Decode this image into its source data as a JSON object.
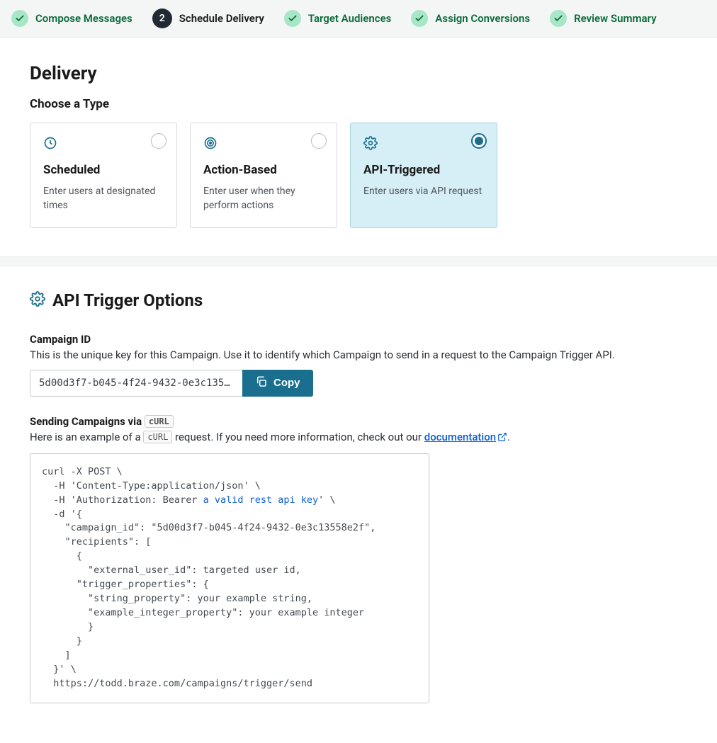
{
  "stepper": {
    "steps": [
      {
        "label": "Compose Messages",
        "state": "completed"
      },
      {
        "label": "Schedule Delivery",
        "state": "active",
        "number": "2"
      },
      {
        "label": "Target Audiences",
        "state": "completed"
      },
      {
        "label": "Assign Conversions",
        "state": "completed"
      },
      {
        "label": "Review Summary",
        "state": "completed"
      }
    ]
  },
  "delivery": {
    "title": "Delivery",
    "subtitle": "Choose a Type",
    "types": [
      {
        "title": "Scheduled",
        "desc": "Enter users at designated times",
        "selected": false,
        "icon": "clock"
      },
      {
        "title": "Action-Based",
        "desc": "Enter user when they perform actions",
        "selected": false,
        "icon": "target"
      },
      {
        "title": "API-Triggered",
        "desc": "Enter users via API request",
        "selected": true,
        "icon": "gear"
      }
    ]
  },
  "api": {
    "header": "API Trigger Options",
    "campaign_id_label": "Campaign ID",
    "campaign_id_desc": "This is the unique key for this Campaign. Use it to identify which Campaign to send in a request to the Campaign Trigger API.",
    "campaign_id_value": "5d00d3f7-b045-4f24-9432-0e3c135...",
    "copy_label": "Copy",
    "sending_label_prefix": "Sending Campaigns via",
    "curl_badge": "cURL",
    "example_prefix": "Here is an example of a",
    "example_suffix": "request. If you need more information, check out our",
    "doc_link_text": "documentation",
    "code_pre1": "curl -X POST \\\n  -H 'Content-Type:application/json' \\\n  -H 'Authorization: Bearer ",
    "code_hl": "a valid rest api key",
    "code_post": "' \\\n  -d '{\n    \"campaign_id\": \"5d00d3f7-b045-4f24-9432-0e3c13558e2f\",\n    \"recipients\": [\n      {\n        \"external_user_id\": targeted user id,\n      \"trigger_properties\": {\n        \"string_property\": your example string,\n        \"example_integer_property\": your example integer\n        }\n      }\n    ]\n  }' \\\n  https://todd.braze.com/campaigns/trigger/send"
  }
}
